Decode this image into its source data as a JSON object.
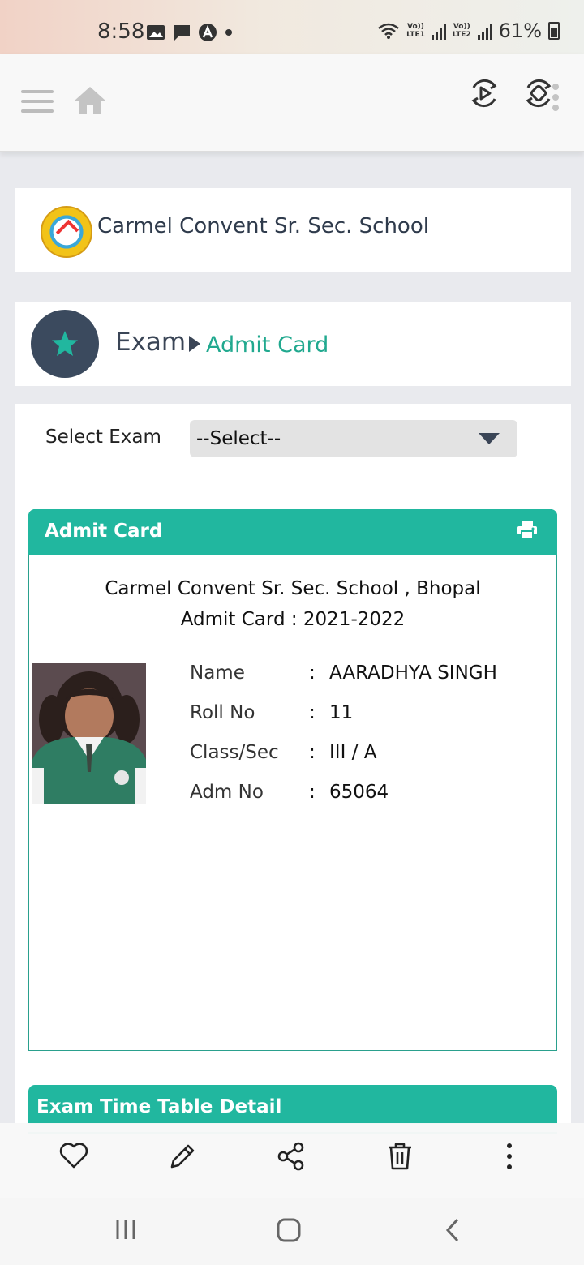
{
  "status_bar": {
    "time": "8:58",
    "sim1": "Vo))\nLTE1",
    "sim2": "Vo))\nLTE2",
    "battery": "61%"
  },
  "toolbar": {
    "icons": [
      "menu-icon",
      "home-icon",
      "play-icon",
      "rotate-icon"
    ]
  },
  "school": {
    "name": "Carmel Convent Sr. Sec. School"
  },
  "breadcrumb": {
    "section": "Exam",
    "page": "Admit Card"
  },
  "form": {
    "label": "Select Exam",
    "value": "--Select--"
  },
  "admit_card": {
    "header": "Admit Card",
    "school_line": "Carmel Convent Sr. Sec. School , Bhopal",
    "year_line": "Admit Card : 2021-2022",
    "rows": [
      {
        "label": "Name",
        "value": "AARADHYA SINGH"
      },
      {
        "label": "Roll No",
        "value": "11"
      },
      {
        "label": "Class/Sec",
        "value": "III / A"
      },
      {
        "label": "Adm No",
        "value": "65064"
      }
    ],
    "colon": ":"
  },
  "timetable": {
    "header": "Exam Time Table Detail"
  },
  "colors": {
    "accent": "#21b79f",
    "dark": "#3b4a5e"
  }
}
